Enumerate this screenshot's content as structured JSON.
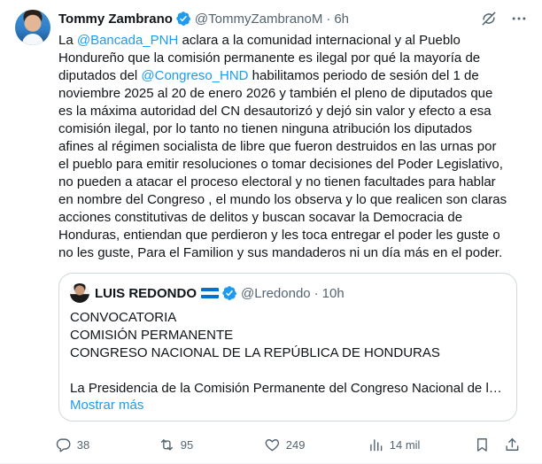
{
  "tweet": {
    "author_name": "Tommy Zambrano",
    "handle": "@TommyZambranoM",
    "separator": "·",
    "time": "6h",
    "lines": [
      [
        {
          "t": "La "
        },
        {
          "t": "@Bancada_PNH",
          "m": true
        },
        {
          "t": " aclara a la comunidad internacional y al Pueblo"
        }
      ],
      [
        {
          "t": "Hondureño que la comisión permanente es ilegal por qué la mayoría de"
        }
      ],
      [
        {
          "t": "diputados del "
        },
        {
          "t": "@Congreso_HND",
          "m": true
        },
        {
          "t": " habilitamos periodo de sesión del 1 de"
        }
      ],
      [
        {
          "t": "noviembre 2025 al 20 de enero 2026 y también el pleno de diputados que"
        }
      ],
      [
        {
          "t": "es la máxima autoridad del CN desautorizó y dejó sin valor y efecto a esa"
        }
      ],
      [
        {
          "t": "comisión ilegal, por lo tanto no tienen ninguna atribución los diputados"
        }
      ],
      [
        {
          "t": "afines al régimen socialista de libre que fueron destruidos en las urnas por"
        }
      ],
      [
        {
          "t": "el pueblo para emitir resoluciones o tomar decisiones del Poder Legislativo,"
        }
      ],
      [
        {
          "t": "no pueden a atacar el proceso electoral y no tienen facultades para hablar"
        }
      ],
      [
        {
          "t": "en nombre del Congreso , el mundo los observa y lo que realicen son claras"
        }
      ],
      [
        {
          "t": "acciones constitutivas de delitos y buscan socavar la Democracia de"
        }
      ],
      [
        {
          "t": "Honduras, entiendan que perdieron y les toca entregar el poder les guste o"
        }
      ],
      [
        {
          "t": "no les guste, Para el Familion y sus mandaderos ni un día más en el poder."
        }
      ]
    ]
  },
  "quote": {
    "author_name": "LUIS REDONDO",
    "handle": "@Lredondo",
    "separator": "·",
    "time": "10h",
    "lines": [
      "CONVOCATORIA",
      "COMISIÓN PERMANENTE",
      "CONGRESO NACIONAL DE LA REPÚBLICA DE HONDURAS",
      "",
      "La Presidencia de la Comisión Permanente del Congreso Nacional de l…"
    ],
    "show_more": "Mostrar más"
  },
  "actions": {
    "replies": "38",
    "reposts": "95",
    "likes": "249",
    "views": "14 mil"
  },
  "colors": {
    "accent": "#1d9bf0",
    "secondary_text": "#536471",
    "border": "#cfd9de",
    "flag_blue": "#0073cf"
  },
  "icons": {
    "verified": "verified-badge-icon",
    "grok": "grok-icon",
    "more": "more-icon",
    "reply": "reply-icon",
    "repost": "repost-icon",
    "like": "heart-icon",
    "views": "views-chart-icon",
    "bookmark": "bookmark-icon",
    "share": "share-icon"
  }
}
